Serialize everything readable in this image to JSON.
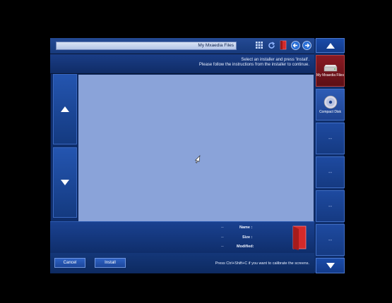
{
  "toolbar": {
    "path": "My Mxaedia Files",
    "icons": [
      "forward-icon",
      "back-icon",
      "door-icon",
      "refresh-icon",
      "grid-view-icon"
    ]
  },
  "info": {
    "line1": "Select an installer and press 'Install'.",
    "line2": "Please follow the instructions from the installer to continue."
  },
  "details": {
    "name_label": "Name :",
    "size_label": "Size :",
    "modified_label": "Modified:",
    "name_value": "--",
    "size_value": "--",
    "modified_value": "--"
  },
  "buttons": {
    "cancel": "Cancel",
    "install": "Install"
  },
  "hint": "Press Ctrl+Shift+C if you want to calibrate the screens.",
  "sidebar": {
    "media_label": "My Mxaedia Files",
    "cd_label": "Compact Disk",
    "empty_label": "--"
  }
}
